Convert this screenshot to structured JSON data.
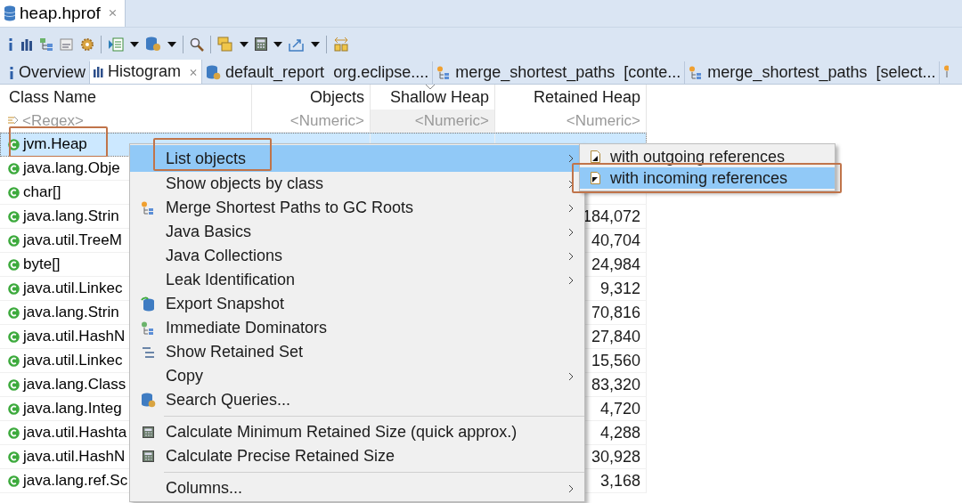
{
  "editor_tab": {
    "title": "heap.hprof",
    "close": "⨯"
  },
  "view_tabs": [
    {
      "kind": "overview",
      "label": "Overview",
      "selected": false,
      "closable": false
    },
    {
      "kind": "histogram",
      "label": "Histogram",
      "selected": true,
      "closable": true
    },
    {
      "kind": "report",
      "label": "default_report  org.eclipse....",
      "selected": false,
      "closable": false
    },
    {
      "kind": "paths",
      "label": "merge_shortest_paths  [conte...",
      "selected": false,
      "closable": false
    },
    {
      "kind": "paths",
      "label": "merge_shortest_paths  [select...",
      "selected": false,
      "closable": false
    }
  ],
  "tab_close": "⨯",
  "table": {
    "columns": [
      {
        "label": "Class Name",
        "filter": "<Regex>",
        "sorted": false
      },
      {
        "label": "Objects",
        "filter": "<Numeric>",
        "sorted": false
      },
      {
        "label": "Shallow Heap",
        "filter": "<Numeric>",
        "sorted": true
      },
      {
        "label": "Retained Heap",
        "filter": "<Numeric>",
        "sorted": false
      }
    ],
    "rows": [
      {
        "name": "jvm.Heap",
        "selected": true,
        "annotated": true
      },
      {
        "name": "java.lang.Obje",
        "selected": false,
        "annotated": false
      },
      {
        "name": "char[]",
        "selected": false,
        "annotated": false
      },
      {
        "name": "java.lang.Strin",
        "retained": "184,072",
        "selected": false,
        "annotated": false
      },
      {
        "name": "java.util.TreeM",
        "retained": "40,704",
        "selected": false,
        "annotated": false
      },
      {
        "name": "byte[]",
        "retained": "24,984",
        "selected": false,
        "annotated": false
      },
      {
        "name": "java.util.Linkec",
        "retained": "9,312",
        "selected": false,
        "annotated": false
      },
      {
        "name": "java.lang.Strin",
        "retained": "70,816",
        "selected": false,
        "annotated": false
      },
      {
        "name": "java.util.HashN",
        "retained": "27,840",
        "selected": false,
        "annotated": false
      },
      {
        "name": "java.util.Linkec",
        "retained": "15,560",
        "selected": false,
        "annotated": false
      },
      {
        "name": "java.lang.Class",
        "retained": "83,320",
        "selected": false,
        "annotated": false
      },
      {
        "name": "java.lang.Integ",
        "retained": "4,720",
        "selected": false,
        "annotated": false
      },
      {
        "name": "java.util.Hashta",
        "retained": "4,288",
        "selected": false,
        "annotated": false
      },
      {
        "name": "java.util.HashN",
        "retained": "30,928",
        "selected": false,
        "annotated": false
      },
      {
        "name": "java.lang.ref.Sc",
        "retained": "3,168",
        "selected": false,
        "annotated": false
      }
    ]
  },
  "context_menu": {
    "items": [
      {
        "kind": "item",
        "label": "List objects",
        "submenu": true,
        "selected": true,
        "annotated": true
      },
      {
        "kind": "item",
        "label": "Show objects by class",
        "submenu": true,
        "selected": false,
        "annotated": false
      },
      {
        "kind": "item",
        "label": "Merge Shortest Paths to GC Roots",
        "submenu": true,
        "selected": false,
        "annotated": false
      },
      {
        "kind": "item",
        "label": "Java Basics",
        "submenu": true,
        "selected": false,
        "annotated": false
      },
      {
        "kind": "item",
        "label": "Java Collections",
        "submenu": true,
        "selected": false,
        "annotated": false
      },
      {
        "kind": "item",
        "label": "Leak Identification",
        "submenu": true,
        "selected": false,
        "annotated": false
      },
      {
        "kind": "item",
        "label": "Export Snapshot",
        "submenu": false,
        "selected": false,
        "annotated": false
      },
      {
        "kind": "item",
        "label": "Immediate Dominators",
        "submenu": false,
        "selected": false,
        "annotated": false
      },
      {
        "kind": "item",
        "label": "Show Retained Set",
        "submenu": false,
        "selected": false,
        "annotated": false
      },
      {
        "kind": "item",
        "label": "Copy",
        "submenu": true,
        "selected": false,
        "annotated": false
      },
      {
        "kind": "item",
        "label": "Search Queries...",
        "submenu": false,
        "selected": false,
        "annotated": false
      },
      {
        "kind": "separator"
      },
      {
        "kind": "item",
        "label": "Calculate Minimum Retained Size (quick approx.)",
        "submenu": false,
        "selected": false,
        "annotated": false
      },
      {
        "kind": "item",
        "label": "Calculate Precise Retained Size",
        "submenu": false,
        "selected": false,
        "annotated": false
      },
      {
        "kind": "separator"
      },
      {
        "kind": "item",
        "label": "Columns...",
        "submenu": true,
        "selected": false,
        "annotated": false
      }
    ]
  },
  "submenu": {
    "items": [
      {
        "label": "with outgoing references",
        "selected": false,
        "annotated": false
      },
      {
        "label": "with incoming references",
        "selected": true,
        "annotated": true
      }
    ]
  }
}
